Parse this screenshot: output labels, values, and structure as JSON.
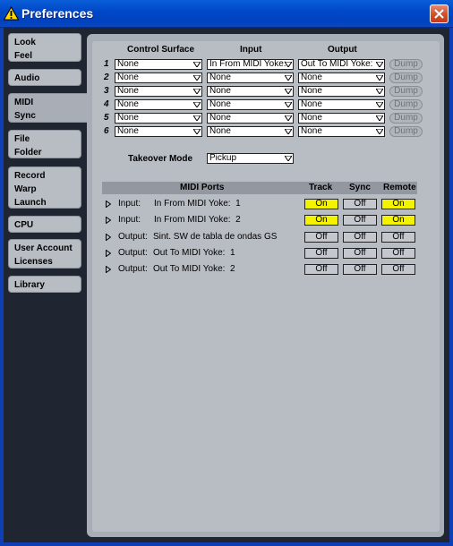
{
  "window": {
    "title": "Preferences"
  },
  "sidebar": {
    "tabs": [
      {
        "lines": [
          "Look",
          "Feel"
        ]
      },
      {
        "lines": [
          "Audio"
        ]
      },
      {
        "lines": [
          "MIDI",
          "Sync"
        ],
        "active": true
      },
      {
        "lines": [
          "File",
          "Folder"
        ]
      },
      {
        "lines": [
          "Record",
          "Warp",
          "Launch"
        ]
      },
      {
        "lines": [
          "CPU"
        ]
      },
      {
        "lines": [
          "User Account",
          "Licenses"
        ]
      },
      {
        "lines": [
          "Library"
        ]
      }
    ]
  },
  "control_surfaces": {
    "headers": {
      "surface": "Control Surface",
      "input": "Input",
      "output": "Output"
    },
    "dump_label": "Dump",
    "rows": [
      {
        "num": "1",
        "surface": "None",
        "input": "In From MIDI Yoke:",
        "output": "Out To MIDI Yoke:"
      },
      {
        "num": "2",
        "surface": "None",
        "input": "None",
        "output": "None"
      },
      {
        "num": "3",
        "surface": "None",
        "input": "None",
        "output": "None"
      },
      {
        "num": "4",
        "surface": "None",
        "input": "None",
        "output": "None"
      },
      {
        "num": "5",
        "surface": "None",
        "input": "None",
        "output": "None"
      },
      {
        "num": "6",
        "surface": "None",
        "input": "None",
        "output": "None"
      }
    ]
  },
  "takeover": {
    "label": "Takeover Mode",
    "value": "Pickup"
  },
  "midi_ports": {
    "headers": {
      "ports": "MIDI Ports",
      "track": "Track",
      "sync": "Sync",
      "remote": "Remote"
    },
    "rows": [
      {
        "direction": "Input:",
        "name": "In From MIDI Yoke:  1",
        "track": "On",
        "sync": "Off",
        "remote": "On"
      },
      {
        "direction": "Input:",
        "name": "In From MIDI Yoke:  2",
        "track": "On",
        "sync": "Off",
        "remote": "On"
      },
      {
        "direction": "Output:",
        "name": "Sint. SW de tabla de ondas GS",
        "track": "Off",
        "sync": "Off",
        "remote": "Off"
      },
      {
        "direction": "Output:",
        "name": "Out To MIDI Yoke:  1",
        "track": "Off",
        "sync": "Off",
        "remote": "Off"
      },
      {
        "direction": "Output:",
        "name": "Out To MIDI Yoke:  2",
        "track": "Off",
        "sync": "Off",
        "remote": "Off"
      }
    ]
  },
  "colors": {
    "on": "#f3f300",
    "off": "#c4c8ce",
    "titlebar": "#0048c8"
  }
}
